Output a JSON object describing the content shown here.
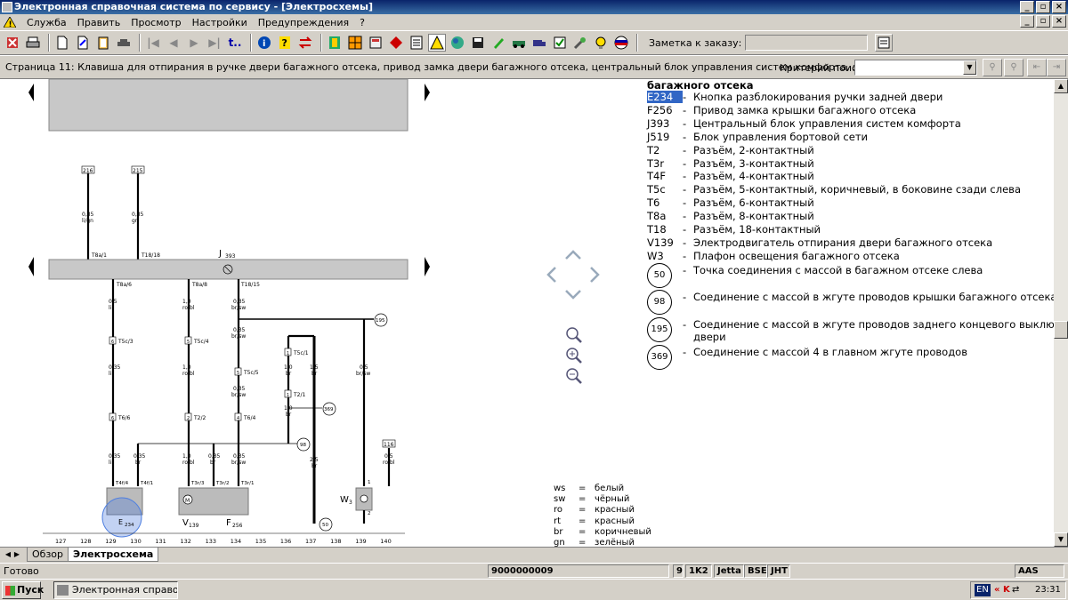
{
  "window": {
    "title": "Электронная справочная система по сервису - [Электросхемы]"
  },
  "menu": {
    "items": [
      "Служба",
      "Править",
      "Просмотр",
      "Настройки",
      "Предупреждения",
      "?"
    ]
  },
  "toolbar": {
    "note_label": "Заметка к заказу:",
    "note_value": ""
  },
  "page": {
    "title": "Страница 11: Клавиша для отпирания в ручке двери багажного отсека, привод замка двери багажного отсека, центральный блок управления систем комфорта, электродвигатель",
    "search_label": "Критерий поиска:",
    "search_value": ""
  },
  "legend": {
    "heading": "багажного отсека",
    "items": [
      {
        "code": "E234",
        "desc": "Кнопка разблокирования ручки задней двери",
        "selected": true
      },
      {
        "code": "F256",
        "desc": "Привод замка крышки багажного отсека"
      },
      {
        "code": "J393",
        "desc": "Центральный блок управления систем комфорта"
      },
      {
        "code": "J519",
        "desc": "Блок управления бортовой сети"
      },
      {
        "code": "T2",
        "desc": "Разъём, 2-контактный"
      },
      {
        "code": "T3r",
        "desc": "Разъём, 3-контактный"
      },
      {
        "code": "T4F",
        "desc": "Разъём, 4-контактный"
      },
      {
        "code": "T5c",
        "desc": "Разъём, 5-контактный, коричневый, в боковине сзади слева"
      },
      {
        "code": "T6",
        "desc": "Разъём, 6-контактный"
      },
      {
        "code": "T8a",
        "desc": "Разъём, 8-контактный"
      },
      {
        "code": "T18",
        "desc": "Разъём, 18-контактный"
      },
      {
        "code": "V139",
        "desc": "Электродвигатель отпирания двери багажного отсека"
      },
      {
        "code": "W3",
        "desc": "Плафон освещения багажного отсека"
      }
    ],
    "grounds": [
      {
        "num": "50",
        "desc": "Точка соединения с массой в багажном отсеке слева",
        "desc2": ""
      },
      {
        "num": "98",
        "desc": "Соединение с массой в жгуте проводов крышки багажного отсека",
        "desc2": ""
      },
      {
        "num": "195",
        "desc": "Соединение с массой в жгуте проводов заднего концевого выключателя",
        "desc2": "двери"
      },
      {
        "num": "369",
        "desc": "Соединение с массой 4 в главном жгуте проводов",
        "desc2": ""
      }
    ],
    "dash": "-"
  },
  "colors": [
    {
      "code": "ws",
      "name": "белый"
    },
    {
      "code": "sw",
      "name": "чёрный"
    },
    {
      "code": "ro",
      "name": "красный"
    },
    {
      "code": "rt",
      "name": "красный"
    },
    {
      "code": "br",
      "name": "коричневый"
    },
    {
      "code": "gn",
      "name": "зелёный"
    }
  ],
  "diagram": {
    "component_J": "J",
    "component_J_sub": "393",
    "top_boxes": [
      "216",
      "215"
    ],
    "top_wires": [
      {
        "size": "0,35",
        "color": "li/gn",
        "pin": "T8a/1"
      },
      {
        "size": "0,35",
        "color": "gn",
        "pin": "T18/18"
      }
    ],
    "bottom_pins": [
      "T8a/6",
      "T8a/8",
      "T18/15"
    ],
    "wire_labels": {
      "w1a": "0,5",
      "w1a_c": "li",
      "w1b": "0,35",
      "w1b_c": "li",
      "w1c": "0,35",
      "w1c_c": "li",
      "w2a": "1,0",
      "w2a_c": "ro/bl",
      "w2b": "1,0",
      "w2b_c": "ro/bl",
      "w2c": "1,0",
      "w2c_c": "ro/bl",
      "w3a": "0,35",
      "w3a_c": "br/sw",
      "w3b": "0,35",
      "w3b_c": "br/sw",
      "w3c": "0,35",
      "w3c_c": "br/sw",
      "w3d": "0,35",
      "w3d_c": "br/sw",
      "wbr1": "0,35",
      "wbr1_c": "br",
      "wbr2": "0,35",
      "wbr2_c": "br",
      "wt5a": "1,0",
      "wt5a_c": "br",
      "wt5b": "1,0",
      "wt5b_c": "br",
      "wt5c": "1,5",
      "wt5c_c": "br",
      "wt5d": "2,5",
      "wt5d_c": "br",
      "wsw": "0,5",
      "wsw_c": "br/sw",
      "wro": "0,5",
      "wro_c": "ro/bl"
    },
    "connectors": {
      "c1": "T5c/3",
      "c2": "T5c/4",
      "c3": "T5c/5",
      "c4": "T5c/1",
      "c5": "T6/6",
      "c6": "T2/2",
      "c7": "T6/4",
      "c8": "T2/1",
      "p1": "T4f/4",
      "p2": "T4f/1",
      "p3": "T3r/3",
      "p4": "T3r/2",
      "p5": "T3r/1",
      "n1": "6",
      "n2": "5",
      "n3": "2",
      "n4": "4",
      "n5": "1",
      "n6": "2",
      "n7": "1",
      "n8": "1",
      "n9": "2"
    },
    "ground_nodes": {
      "g195": "195",
      "g369": "369",
      "g98": "98",
      "g50": "50",
      "b116": "116"
    },
    "components": {
      "E": "E",
      "E_sub": "234",
      "V": "V",
      "V_sub": "139",
      "F": "F",
      "F_sub": "256",
      "W": "W",
      "W_sub": "3",
      "M": "M"
    },
    "columns": [
      "127",
      "128",
      "129",
      "130",
      "131",
      "132",
      "133",
      "134",
      "135",
      "136",
      "137",
      "138",
      "139",
      "140"
    ]
  },
  "tabs": {
    "overview": "Обзор",
    "schema": "Электросхема"
  },
  "status": {
    "ready": "Готово",
    "vin": "9000000009",
    "f1": "9",
    "f2": "1K2",
    "f3": "Jetta",
    "f4": "BSE",
    "f5": "JHT",
    "f6": "AAS"
  },
  "taskbar": {
    "start": "Пуск",
    "task": "Электронная справо...",
    "lang": "EN",
    "time": "23:31"
  }
}
